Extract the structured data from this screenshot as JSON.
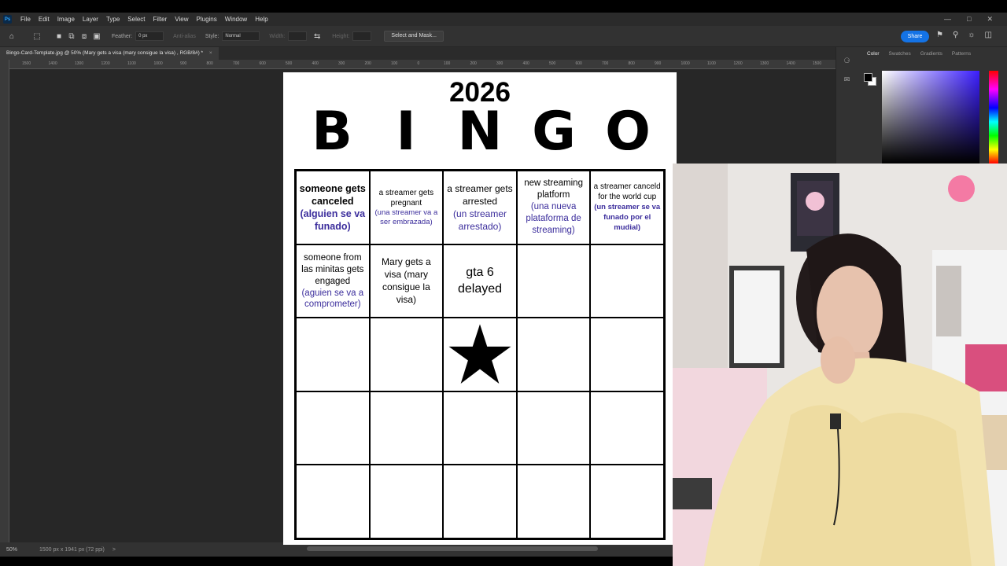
{
  "app": {
    "menu": [
      "File",
      "Edit",
      "Image",
      "Layer",
      "Type",
      "Select",
      "Filter",
      "View",
      "Plugins",
      "Window",
      "Help"
    ],
    "logo_text": "Ps"
  },
  "options": {
    "feather_label": "Feather:",
    "feather_value": "0 px",
    "anti_alias_label": "Anti-alias",
    "style_label": "Style:",
    "style_value": "Normal",
    "width_label": "Width:",
    "height_label": "Height:",
    "select_mask_label": "Select and Mask...",
    "share_label": "Share"
  },
  "document_tab": {
    "title": "Bingo-Card-Template.jpg @ 50% (Mary gets  a visa (mary consigue la visa) , RGB/8#) *",
    "close": "×"
  },
  "ruler_numbers": [
    "1500",
    "1400",
    "1300",
    "1200",
    "1100",
    "1000",
    "900",
    "800",
    "700",
    "600",
    "500",
    "400",
    "300",
    "200",
    "100",
    "0",
    "100",
    "200",
    "300",
    "400",
    "500",
    "600",
    "700",
    "800",
    "900",
    "1000",
    "1100",
    "1200",
    "1300",
    "1400",
    "1500",
    "1600",
    "1700",
    "1800",
    "1900",
    "2000"
  ],
  "status": {
    "zoom": "50%",
    "doc_info": "1500 px x 1941 px (72 ppi)",
    "nav_arrow": ">"
  },
  "panel": {
    "tabs": [
      "Color",
      "Swatches",
      "Gradients",
      "Patterns"
    ]
  },
  "bingo": {
    "year": "2026",
    "letters": [
      "B",
      "I",
      "N",
      "G",
      "O"
    ],
    "cells": [
      {
        "en": "someone gets canceled",
        "es": "(alguien se va funado)"
      },
      {
        "en": "a streamer gets pregnant",
        "es": "(una streamer va a ser embrazada)"
      },
      {
        "en": "a streamer gets arrested",
        "es": "(un streamer arrestado)"
      },
      {
        "en": "new streaming platform",
        "es": "(una nueva plataforma de streaming)"
      },
      {
        "en": "a streamer canceld for the world cup",
        "es": "(un streamer se va funado por el mudial)"
      },
      {
        "en": "someone from las minitas gets engaged",
        "es": "(aguien se va a comprometer)"
      },
      {
        "en": "Mary gets a visa (mary consigue la visa)",
        "es": ""
      },
      {
        "en": "gta 6 delayed",
        "es": ""
      },
      {
        "en": "",
        "es": ""
      },
      {
        "en": "",
        "es": ""
      },
      {
        "en": "",
        "es": ""
      },
      {
        "en": "",
        "es": ""
      },
      {
        "en": "",
        "es": "",
        "star": true
      },
      {
        "en": "",
        "es": ""
      },
      {
        "en": "",
        "es": ""
      },
      {
        "en": "",
        "es": ""
      },
      {
        "en": "",
        "es": ""
      },
      {
        "en": "",
        "es": ""
      },
      {
        "en": "",
        "es": ""
      },
      {
        "en": "",
        "es": ""
      },
      {
        "en": "",
        "es": ""
      },
      {
        "en": "",
        "es": ""
      },
      {
        "en": "",
        "es": ""
      },
      {
        "en": "",
        "es": ""
      },
      {
        "en": "",
        "es": ""
      }
    ]
  },
  "colors": {
    "accent": "#1473e6",
    "spanish_text": "#3b2d9c",
    "ps_dark": "#2b2b2b"
  }
}
